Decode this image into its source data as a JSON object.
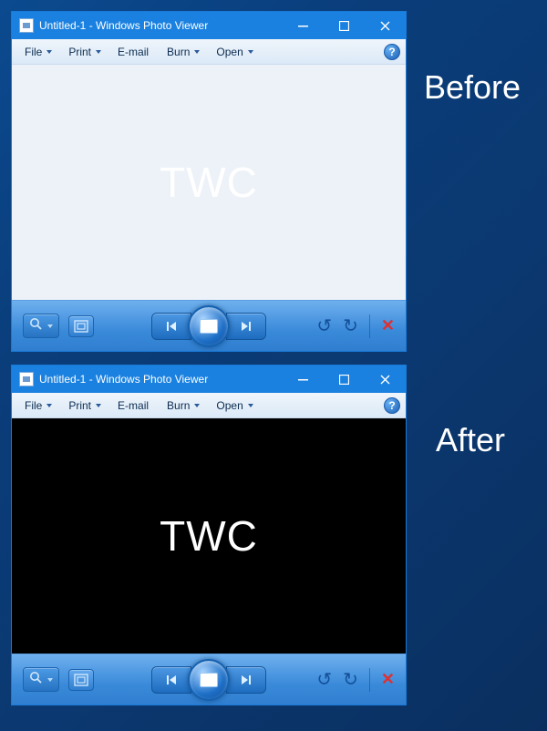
{
  "outer_labels": {
    "before": "Before",
    "after": "After"
  },
  "window": {
    "title": "Untitled-1 - Windows Photo Viewer",
    "menus": {
      "file": "File",
      "print": "Print",
      "email": "E-mail",
      "burn": "Burn",
      "open": "Open"
    },
    "help_label": "?",
    "canvas_text": "TWC"
  }
}
